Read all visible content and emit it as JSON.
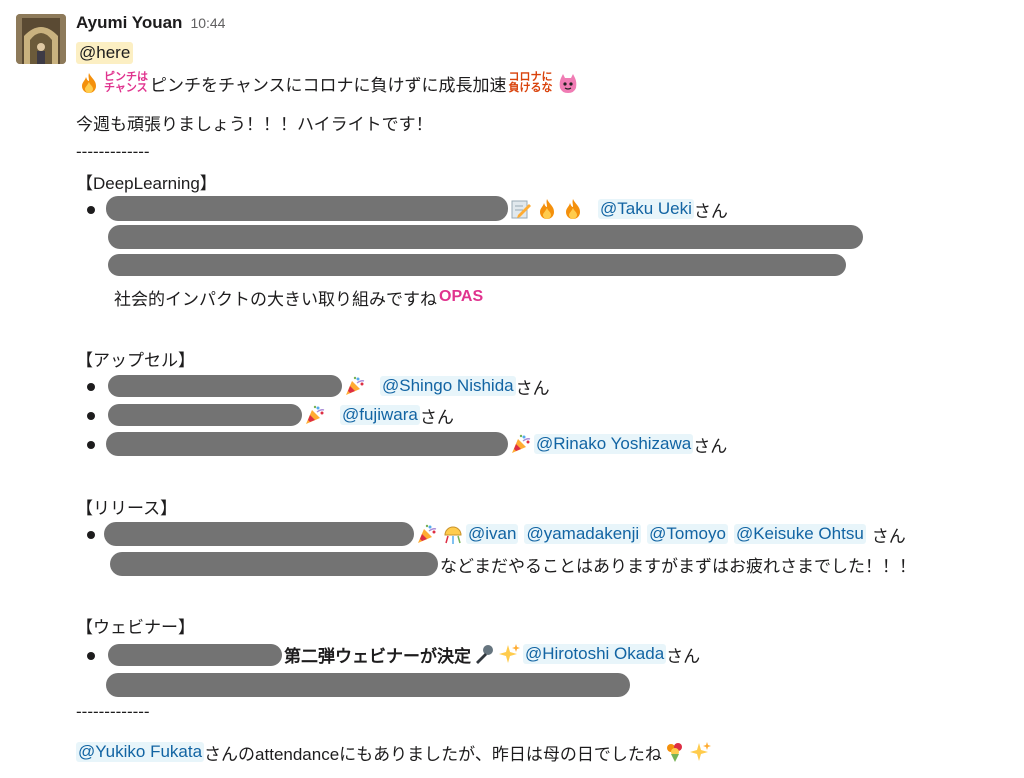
{
  "message": {
    "sender": "Ayumi Youan",
    "time": "10:44",
    "here": "@here",
    "headline": "ピンチをチャンスにコロナに負けずに成長加速",
    "sticker_pinch_line1": "ピンチは",
    "sticker_pinch_line2": "チャンス",
    "sticker_corona_line1": "コロナに",
    "sticker_corona_line2": "負けるな",
    "intro": "今週も頑張りましょう！！！ハイライトです！",
    "divider": "-------------",
    "san": "さん",
    "opas": "OPAS",
    "sections": {
      "deeplearning": {
        "title": "【DeepLearning】",
        "mention": "@Taku Ueki",
        "text": "社会的インパクトの大きい取り組みですね"
      },
      "upsell": {
        "title": "【アップセル】",
        "mention1": "@Shingo Nishida",
        "mention2": "@fujiwara",
        "mention3": "@Rinako Yoshizawa"
      },
      "release": {
        "title": "【リリース】",
        "mentions": [
          "@ivan",
          "@yamadakenji",
          "@Tomoyo",
          "@Keisuke Ohtsu"
        ],
        "text": "などまだやることはありますがまずはお疲れさまでした！！！"
      },
      "webinar": {
        "title": "【ウェビナー】",
        "bold_text": "第二弾ウェビナーが決定",
        "mention": "@Hirotoshi Okada"
      }
    },
    "footer": {
      "mention": "@Yukiko Fukata",
      "text": "さんのattendanceにもありましたが、昨日は母の日でしたね"
    }
  },
  "colors": {
    "mention_bg": "#e8f5fa",
    "mention_text": "#1264a3",
    "here_bg": "#fcefc3",
    "redaction": "#737373"
  }
}
